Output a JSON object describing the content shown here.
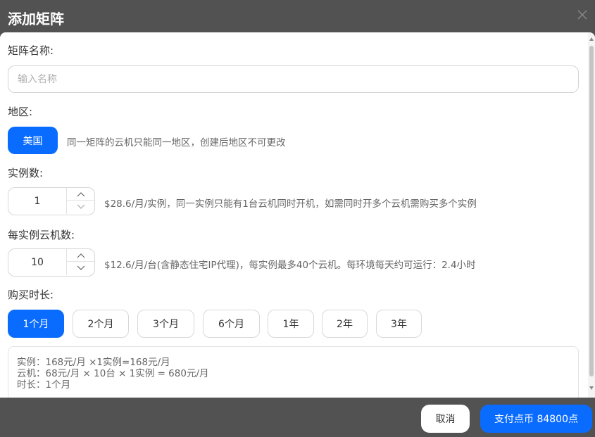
{
  "dialog": {
    "title": "添加矩阵"
  },
  "form": {
    "name": {
      "label": "矩阵名称:",
      "value": "",
      "placeholder": "输入名称"
    },
    "region": {
      "label": "地区:",
      "selected": "美国",
      "hint": "同一矩阵的云机只能同一地区，创建后地区不可更改"
    },
    "instances": {
      "label": "实例数:",
      "value": "1",
      "hint": "$28.6/月/实例，同一实例只能有1台云机同时开机，如需同时开多个云机需购买多个实例"
    },
    "machines_per_instance": {
      "label": "每实例云机数:",
      "value": "10",
      "hint": "$12.6/月/台(含静态住宅IP代理)，每实例最多40个云机。每环境每天约可运行：2.4小时"
    },
    "duration": {
      "label": "购买时长:",
      "options": [
        "1个月",
        "2个月",
        "3个月",
        "6个月",
        "1年",
        "2年",
        "3年"
      ],
      "selected_index": 0
    },
    "summary": {
      "lines": [
        "实例：168元/月 ×1实例=168元/月",
        "云机：68元/月 × 10台 × 1实例 = 680元/月",
        "时长：1个月"
      ]
    }
  },
  "footer": {
    "cancel_label": "取消",
    "pay_label": "支付点币 84800点"
  },
  "colors": {
    "primary": "#0a6cff",
    "overlay": "#525252",
    "border": "#d8d8d8",
    "hint_text": "#666666"
  },
  "icons": {
    "close": "close-icon",
    "stepper_up": "chevron-up-icon",
    "stepper_down": "chevron-down-icon"
  }
}
